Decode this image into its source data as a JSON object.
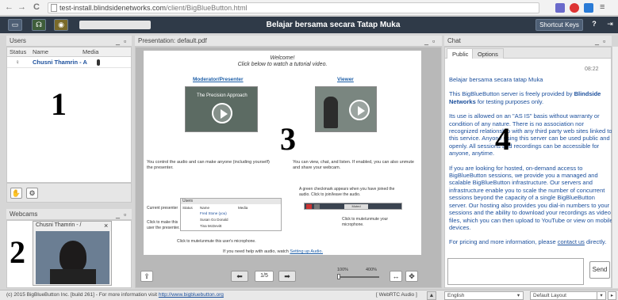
{
  "browser": {
    "url_host": "test-install.blindsidenetworks.com",
    "url_path": "/client/BigBlueButton.html",
    "nav_back": "←",
    "nav_forward": "→",
    "nav_reload": "C"
  },
  "topbar": {
    "meeting_title": "Belajar bersama secara Tatap Muka",
    "shortcut_keys": "Shortcut Keys",
    "help": "?",
    "logout": "⇥"
  },
  "users_panel": {
    "title": "Users",
    "columns": [
      "Status",
      "Name",
      "Media"
    ],
    "rows": [
      {
        "name": "Chusni Thamrin - A"
      }
    ]
  },
  "webcams_panel": {
    "title": "Webcams",
    "webcam_name": "Chusni Thamrin - /",
    "close": "×"
  },
  "presentation": {
    "title": "Presentation: default.pdf",
    "welcome_line1": "Welcome!",
    "welcome_line2": "Click below to watch a tutorial video.",
    "moderator_link": "Moderator/Presenter",
    "viewer_link": "Viewer",
    "video_caption": "The Precision Approach",
    "moderator_text": "You control the audio and can make anyone (including yourself) the presenter.",
    "viewer_text": "You can view, chat, and listen. If enabled, you can also unmute and share your webcam.",
    "mini_users_title": "Users",
    "mini_cols": [
      "Status",
      "Name",
      "Media"
    ],
    "mini_rows": [
      "Fred Stone (you)",
      "Susan Go Donald",
      "Tina McDevitt"
    ],
    "current_presenter": "Current presenter",
    "click_make_presenter": "Click to make this user the presenter.",
    "click_mute_user": "Click to mute/unmute this user's microphone.",
    "green_check_text": "A green checkmark appears when you have joined the audio. Click to join/leave the audio.",
    "click_mute_mic": "Click to mute/unmute your microphone.",
    "mini_btn_label": "Muted",
    "audio_help_prefix": "If you need help with audio, watch",
    "audio_help_link": "Setting up Audio.",
    "page_counter": "1/5",
    "zoom_min": "100%",
    "zoom_max": "400%"
  },
  "chat_panel": {
    "title": "Chat",
    "tabs": [
      "Public",
      "Options"
    ],
    "timestamp": "08:22",
    "msg_title": "Belajar bersama secara tatap Muka",
    "msg1_a": "This BigBlueButton server is freely provided by ",
    "msg1_b": "Blindside Networks",
    "msg1_c": " for testing purposes only.",
    "msg2": "Its use is allowed on an \"AS IS\" basis without warranty or condition of any nature. There is no association nor recognized relationship with any third party web sites linked to this service. Anyone using this server can be used public and openly. All sessions and recordings can be accessible for anyone, anytime.",
    "msg3": "If you are looking for hosted, on-demand access to BigBlueButton sessions, we provide you a managed and scalable BigBlueButton infrastructure. Our servers and infrastructure enable you to scale the number of concurrent sessions beyond the capacity of a single BigBlueButton server. Our hosting also provides you dial-in numbers to your sessions and the ability to download your recordings as video files, which you can then upload to YouTube or view on mobile devices.",
    "msg4_a": "For pricing and more information, please ",
    "msg4_b": "contact us",
    "msg4_c": " directly.",
    "send": "Send"
  },
  "footer": {
    "copyright": "(c) 2015 BigBlueButton Inc. [build 261] - For more information visit ",
    "link": "http://www.bigbluebutton.org",
    "webrtc": "[ WebRTC Audio ]",
    "language": "English",
    "layout": "Default Layout"
  },
  "annotations": [
    "1",
    "2",
    "3",
    "4"
  ]
}
